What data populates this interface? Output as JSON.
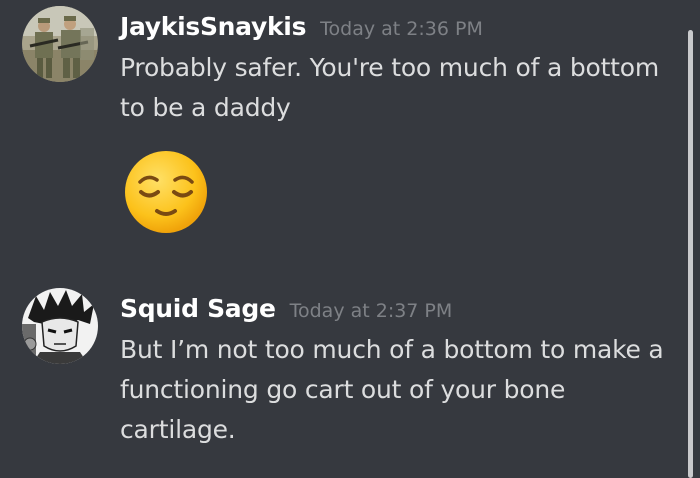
{
  "messages": [
    {
      "username": "JaykisSnaykis",
      "timestamp": "Today at 2:36 PM",
      "text": "Probably safer. You're too much of a bottom to be a daddy",
      "avatar_icon": "soldiers-photo-avatar",
      "emoji": "relieved-face"
    },
    {
      "username": "Squid Sage",
      "timestamp": "Today at 2:37 PM",
      "text": "But I’m not too much of a bottom to make a functioning go cart out of your bone cartilage.",
      "avatar_icon": "manga-character-avatar"
    }
  ],
  "colors": {
    "background": "#36393f",
    "username": "#ffffff",
    "message_text": "#dcddde",
    "timestamp": "#7e8186"
  }
}
